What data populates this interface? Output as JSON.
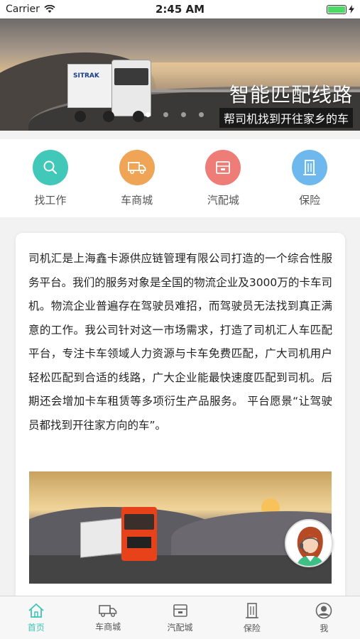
{
  "status": {
    "carrier": "Carrier",
    "time": "2:45 AM"
  },
  "banner": {
    "title": "智能匹配线路",
    "subtitle": "帮司机找到开往家乡的车",
    "truck_logo": "SITRAK",
    "slide_count": 4,
    "active_slide": 1
  },
  "categories": [
    {
      "label": "找工作",
      "icon": "search-icon",
      "color": "#41c8b8"
    },
    {
      "label": "车商城",
      "icon": "truck-icon",
      "color": "#f0a455"
    },
    {
      "label": "汽配城",
      "icon": "parts-box-icon",
      "color": "#ee7d78"
    },
    {
      "label": "保险",
      "icon": "building-icon",
      "color": "#6fb8ee"
    }
  ],
  "intro": {
    "text": "司机汇是上海鑫卡源供应链管理有限公司打造的一个综合性服务平台。我们的服务对象是全国的物流企业及3000万的卡车司机。物流企业普遍存在驾驶员难招，而驾驶员无法找到真正满意的工作。我公司针对这一市场需求，打造了司机汇人车匹配平台，专注卡车领域人力资源与卡车免费匹配，广大司机用户轻松匹配到合适的线路，广大企业能最快速度匹配到司机。后期还会增加卡车租赁等多项衍生产品服务。 平台愿景“让驾驶员都找到开往家方向的车”。"
  },
  "tabbar": [
    {
      "label": "首页",
      "icon": "home-icon",
      "active": true
    },
    {
      "label": "车商城",
      "icon": "truck-icon",
      "active": false
    },
    {
      "label": "汽配城",
      "icon": "parts-box-icon",
      "active": false
    },
    {
      "label": "保险",
      "icon": "building-icon",
      "active": false
    },
    {
      "label": "我",
      "icon": "profile-icon",
      "active": false
    }
  ],
  "colors": {
    "accent": "#3dc4b5",
    "tab_inactive": "#555555"
  }
}
